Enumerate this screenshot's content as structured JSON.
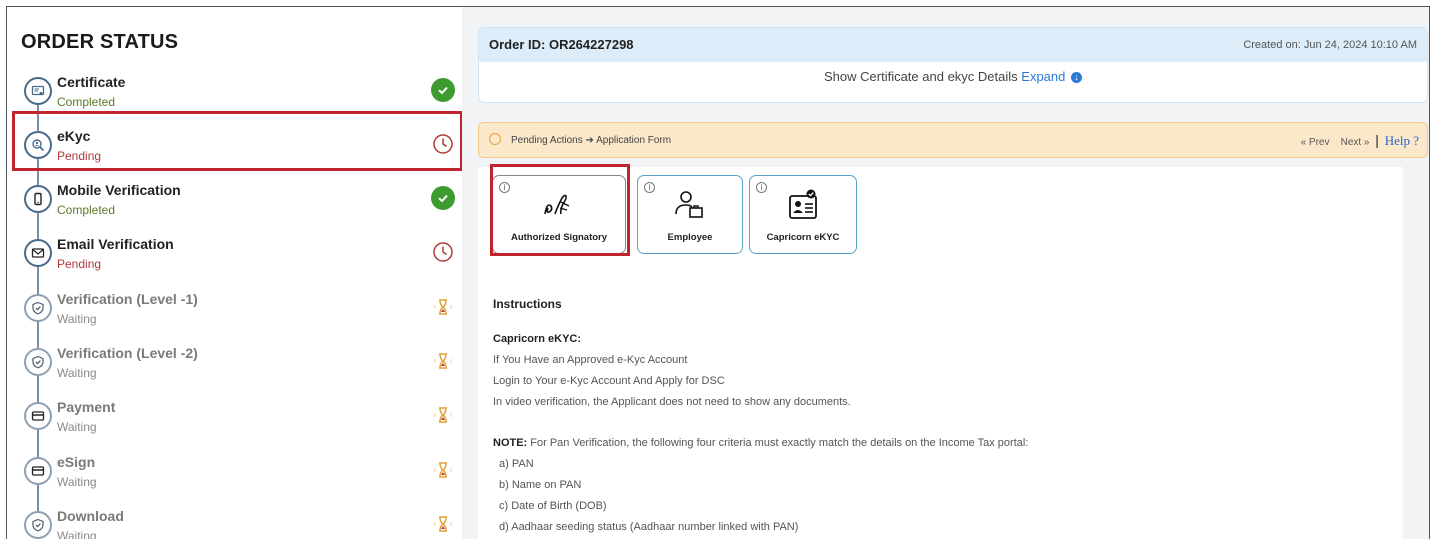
{
  "sidebar": {
    "title": "ORDER STATUS",
    "steps": [
      {
        "label": "Certificate",
        "status": "Completed",
        "state": "completed",
        "icon": "certificate-icon"
      },
      {
        "label": "eKyc",
        "status": "Pending",
        "state": "pending",
        "icon": "search-person-icon"
      },
      {
        "label": "Mobile Verification",
        "status": "Completed",
        "state": "completed",
        "icon": "mobile-icon"
      },
      {
        "label": "Email Verification",
        "status": "Pending",
        "state": "pending",
        "icon": "mail-icon"
      },
      {
        "label": "Verification (Level -1)",
        "status": "Waiting",
        "state": "waiting",
        "icon": "shield-check-icon"
      },
      {
        "label": "Verification (Level -2)",
        "status": "Waiting",
        "state": "waiting",
        "icon": "shield-check-icon"
      },
      {
        "label": "Payment",
        "status": "Waiting",
        "state": "waiting",
        "icon": "card-icon"
      },
      {
        "label": "eSign",
        "status": "Waiting",
        "state": "waiting",
        "icon": "card-icon"
      },
      {
        "label": "Download",
        "status": "Waiting",
        "state": "waiting",
        "icon": "shield-check-icon"
      }
    ]
  },
  "order": {
    "id_label": "Order ID: OR264227298",
    "created": "Created on: Jun 24, 2024 10:10 AM",
    "expand_text": "Show Certificate and ekyc Details",
    "expand_link": "Expand"
  },
  "pending_bar": {
    "breadcrumb": "Pending Actions ➔ Application Form",
    "prev": "« Prev",
    "next": "Next »",
    "separator": "|",
    "help": "Help ?"
  },
  "tiles": [
    {
      "label": "Authorized Signatory",
      "icon": "signature-icon",
      "selected": true
    },
    {
      "label": "Employee",
      "icon": "employee-icon",
      "selected": false
    },
    {
      "label": "Capricorn eKYC",
      "icon": "id-card-icon",
      "selected": false
    }
  ],
  "instructions": {
    "title": "Instructions",
    "section_title": "Capricorn eKYC:",
    "lines": [
      "If You Have an Approved e-Kyc Account",
      "Login to Your e-Kyc Account And Apply for DSC",
      "In video verification, the Applicant does not need to show any documents."
    ],
    "note_label": "NOTE:",
    "note_text": " For Pan Verification, the following four criteria must exactly match the details on the Income Tax portal:",
    "criteria": [
      "a) PAN",
      "b) Name on PAN",
      "c) Date of Birth (DOB)",
      "d) Aadhaar seeding status (Aadhaar number linked with PAN)"
    ]
  },
  "colors": {
    "completed": "#3e9b2f",
    "pending": "#b03a3a",
    "waiting": "#e3a33a",
    "highlight": "#c0252e",
    "link": "#2a7bd6"
  }
}
